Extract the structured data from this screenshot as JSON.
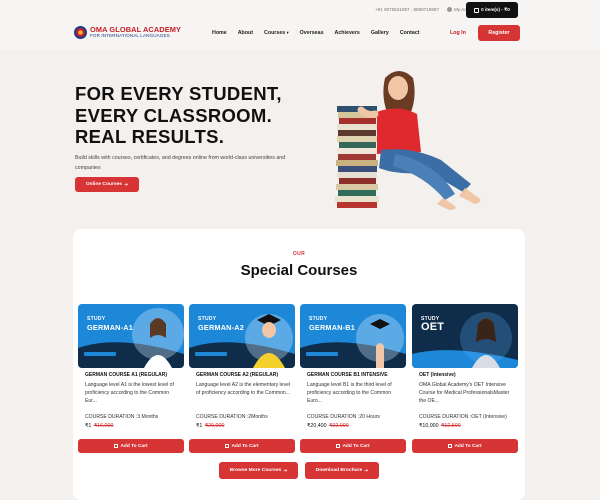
{
  "header": {
    "phones": "+91 8075521897 , 8590719897",
    "account": "My Account",
    "cart": "0 item(s) - ₹0",
    "logo_title": "OMA GLOBAL ACADEMY",
    "logo_sub": "FOR INTERNATIONAL LANGUAGES",
    "nav": [
      {
        "label": "Home"
      },
      {
        "label": "About"
      },
      {
        "label": "Courses"
      },
      {
        "label": "Overseas"
      },
      {
        "label": "Achievers"
      },
      {
        "label": "Gallery"
      },
      {
        "label": "Contact"
      }
    ],
    "login": "Log In",
    "register": "Register"
  },
  "hero": {
    "title_lines": [
      "FOR EVERY STUDENT,",
      "EVERY CLASSROOM.",
      "REAL RESULTS."
    ],
    "description": "Build skills with courses, certificates, and degrees online from world-class universities and companies",
    "cta": "Online Courses"
  },
  "courses": {
    "eyebrow": "OUR",
    "heading": "Special Courses",
    "items": [
      {
        "banner_study": "STUDY",
        "banner_name": "GERMAN-A1",
        "title": "GERMAN COURSE A1 (REGULAR)",
        "description": "Language level A1 is the lowest level of proficiency according to the Common Eur...",
        "duration": "COURSE DURATION :3 Months",
        "price": "₹1",
        "old_price": "₹16,000",
        "button": "Add To Cart"
      },
      {
        "banner_study": "STUDY",
        "banner_name": "GERMAN-A2",
        "title": "GERMAN COURSE A2 (REGULAR)",
        "description": "Language level A2 is the elementary level of proficiency according to the Common...",
        "duration": "COURSE DURATION :2Months",
        "price": "₹1",
        "old_price": "₹20,000",
        "button": "Add To Cart"
      },
      {
        "banner_study": "STUDY",
        "banner_name": "GERMAN-B1",
        "title": "GERMAN COURSE B1 INTENSIVE",
        "description": "Language level B1 is the third level of proficiency according to the Common Euro...",
        "duration": "COURSE DURATION :20 Hours",
        "price": "₹20,400",
        "old_price": "₹22,000",
        "button": "Add To Cart"
      },
      {
        "banner_study": "STUDY",
        "banner_name": "OET",
        "title": "OET (Intensive)",
        "description": "OMA Global Academy's OET Intensive Course for Medical ProfessionalsMaster the OE...",
        "duration": "COURSE DURATION :OET (Intensive)",
        "price": "₹10,000",
        "old_price": "₹12,500",
        "button": "Add To Cart"
      }
    ],
    "browse": "Browse More Courses",
    "brochure": "Download Brochure"
  },
  "colors": {
    "accent": "#d63435",
    "banner_blue": "#1e88d8",
    "banner_dark": "#0f2d4a",
    "page_bg": "#f3f0ee"
  }
}
